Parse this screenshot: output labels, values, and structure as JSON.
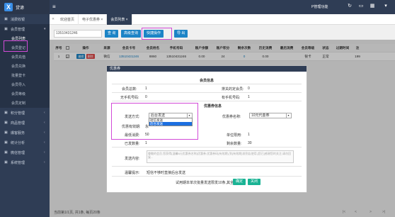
{
  "app": {
    "brand": "贷谛",
    "brand_mark": "X",
    "admin_label": "P管理功能"
  },
  "sidebar": {
    "items": [
      {
        "label": "消费收银",
        "icon": "cart-icon"
      },
      {
        "label": "会员管理",
        "icon": "users-icon"
      }
    ],
    "sub_items": [
      "会员列表",
      "会员登记",
      "会员充值",
      "会员兑换",
      "批量登卡",
      "会员导入",
      "会员等级",
      "会员定制"
    ],
    "more_items": [
      "积分管理",
      "商品管理",
      "爆客服务",
      "统计分析",
      "微信管理",
      "系统管理"
    ]
  },
  "tabs": [
    "欢迎首页",
    "电子优惠券 ×",
    "会员列表 ×"
  ],
  "toolbar": {
    "search_value": "13510431246",
    "search_btn": "查 询",
    "advanced_btn": "高级查询",
    "quick_btn": "快捷操作",
    "export_btn": "导 出"
  },
  "table": {
    "headers": [
      "序号",
      "",
      "操作",
      "来源",
      "会员卡号",
      "会员姓名",
      "手机号码",
      "账户余额",
      "账户积分",
      "剩余次数",
      "历史消费",
      "最后消费",
      "会员等级",
      "状态",
      "过期时间",
      "注"
    ],
    "row": [
      "1",
      "",
      "",
      "微信",
      "13510431246",
      "8860",
      "13510431246",
      "0.00",
      "24",
      "0",
      "0.00",
      "",
      "银卡",
      "正常",
      "",
      "199"
    ],
    "edit_label": "编辑",
    "delete_label": "删除"
  },
  "footer": {
    "text": "当前第1/1页, 共1条, 每页20条",
    "pager": [
      "|<",
      "<",
      ">",
      ">|"
    ]
  },
  "dialog": {
    "title": "优惠券",
    "member_section": "会员信息",
    "total_members_label": "会员总数:",
    "total_members_value": "1",
    "locked_label": "排关的定会员:",
    "locked_value": "0",
    "no_phone_label": "无手机号码:",
    "no_phone_value": "0",
    "has_phone_label": "有手机号码:",
    "has_phone_value": "1",
    "coupon_section": "优惠券信息",
    "send_method_label": "发送方式:",
    "send_method_value": "后台发送",
    "send_options": [
      "短信发送",
      "后台发送"
    ],
    "coupon_name_label": "优惠券名称:",
    "coupon_name_value": "10元代金券",
    "valid_label": "优惠有效期:",
    "valid_value": "永",
    "min_spend_label": "最低消费:",
    "min_spend_value": "50",
    "single_limit_label": "单位限用:",
    "single_limit_value": "1",
    "sent_label": "已发数量:",
    "sent_value": "1",
    "remain_label": "剩余数量:",
    "remain_value": "30",
    "content_label": "发送内容:",
    "content_text": "尊敬的会员,您获得{温馨8元优惠券名称}优惠券,优惠券码{有效期},到{有效期}前到店使用,[您已]感谢您的关注,请勿回复...",
    "tip_label": "温馨提示:",
    "tip_value": "短信不够时直接后台发送",
    "notice": "试用期本单次批量发送限发10条,其全功能",
    "confirm_btn": "确定",
    "close_btn": "关闭"
  },
  "colors": {
    "nav": "#2f3d55",
    "primary": "#1c84c6",
    "highlight": "#d24bd7",
    "success": "#1ab394"
  }
}
